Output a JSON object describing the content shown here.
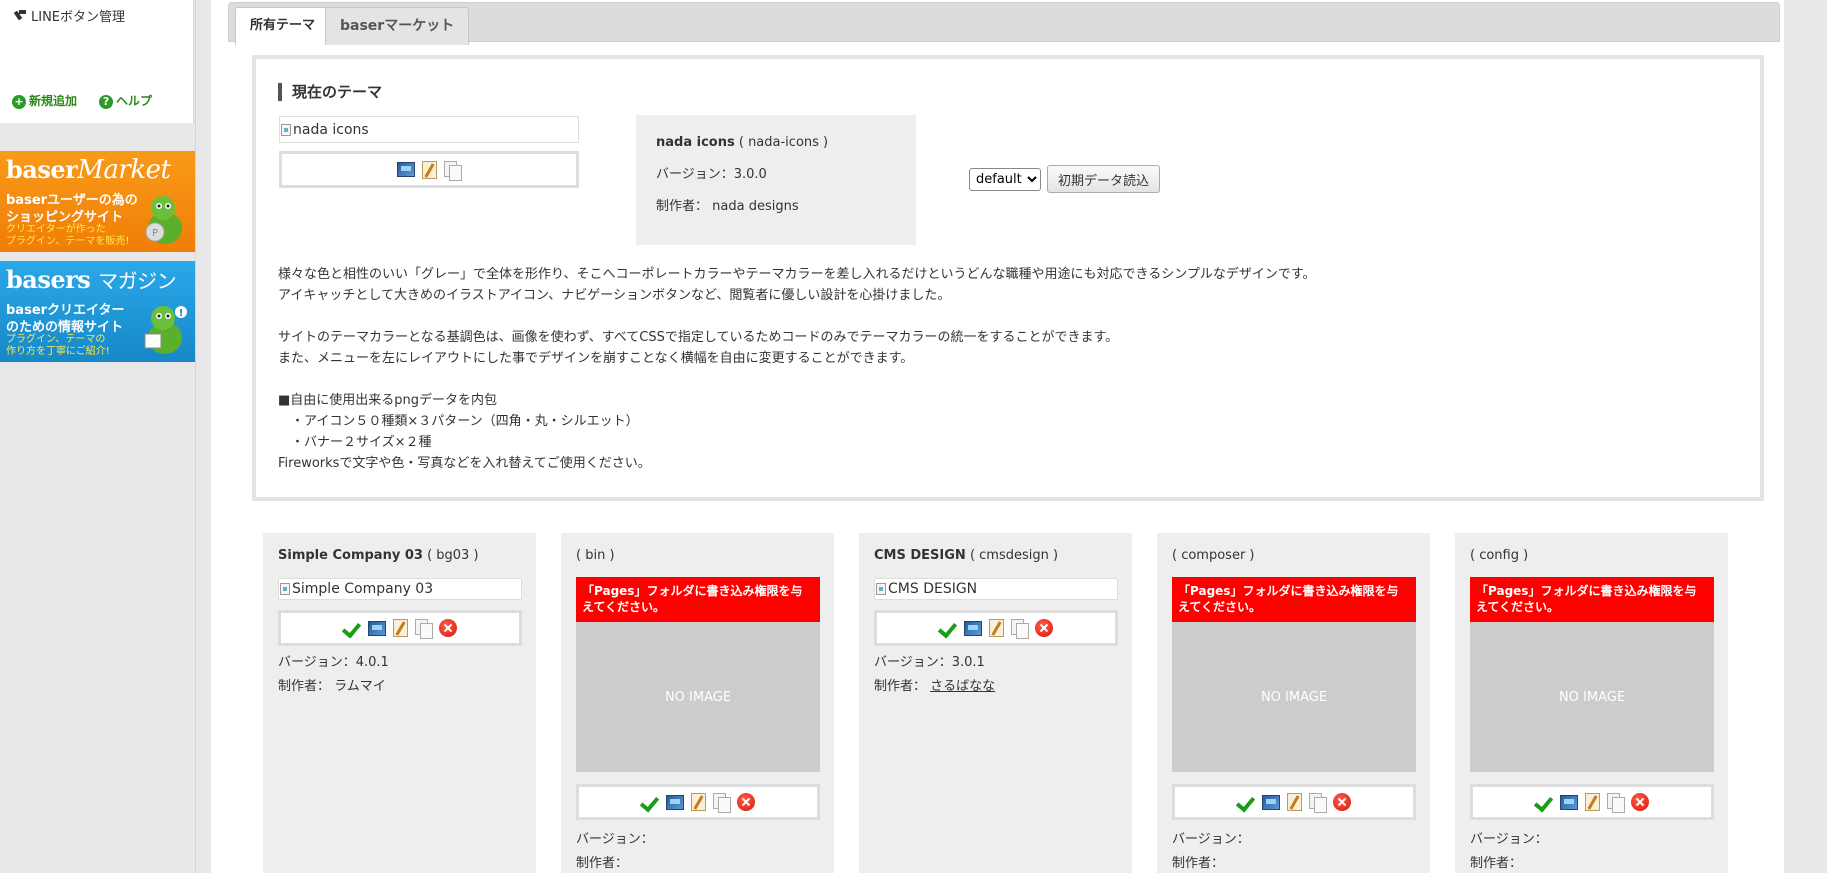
{
  "sidebar": {
    "menu_item": "LINEボタン管理",
    "add_label": "新規追加",
    "help_label": "ヘルプ",
    "banner_market": {
      "title_a": "baser",
      "title_b": "Market",
      "line1": "baserユーザーの為の",
      "line2": "ショッピングサイト",
      "small1": "クリエイターが作った",
      "small2": "プラグイン、テーマを販売!"
    },
    "banner_magazine": {
      "title_a": "basers",
      "title_b": "マガジン",
      "line1": "baserクリエイター",
      "line2": "のための情報サイト",
      "small1": "プラグイン、テーマの",
      "small2": "作り方を丁寧にご紹介!"
    }
  },
  "tabs": {
    "owned": "所有テーマ",
    "market": "baserマーケット"
  },
  "current": {
    "heading": "現在のテーマ",
    "img_alt": "nada icons",
    "name": "nada icons",
    "slug": "( nada-icons )",
    "version": "バージョン：3.0.0",
    "author_label": "制作者：",
    "author": "nada designs",
    "select_value": "default",
    "init_button": "初期データ読込",
    "description": [
      "様々な色と相性のいい「グレー」で全体を形作り、そこへコーポレートカラーやテーマカラーを差し入れるだけというどんな職種や用途にも対応できるシンプルなデザインです。",
      "アイキャッチとして大きめのイラストアイコン、ナビゲーションボタンなど、閲覧者に優しい設計を心掛けました。",
      "",
      "サイトのテーマカラーとなる基調色は、画像を使わず、すべてCSSで指定しているためコードのみでテーマカラーの統一をすることができます。",
      "また、メニューを左にレイアウトにした事でデザインを崩すことなく横幅を自由に変更することができます。",
      "",
      "■自由に使用出来るpngデータを内包",
      "　・アイコン５０種類×３パターン（四角・丸・シルエット）",
      "　・バナー２サイズ×２種",
      "Fireworksで文字や色・写真などを入れ替えてご使用ください。"
    ]
  },
  "cards": [
    {
      "name": "Simple Company 03",
      "slug": "( bg03 )",
      "img_alt": "Simple Company 03",
      "version": "バージョン：4.0.1",
      "author_label": "制作者：",
      "author": "ラムマイ"
    },
    {
      "name": "",
      "slug": "( bin )",
      "warning": "「Pages」フォルダに書き込み権限を与えてください。",
      "noimage": "NO IMAGE",
      "version": "バージョン：",
      "author_label": "制作者："
    },
    {
      "name": "CMS DESIGN",
      "slug": "( cmsdesign )",
      "img_alt": "CMS DESIGN",
      "version": "バージョン：3.0.1",
      "author_label": "制作者：",
      "author": "さるばなな"
    },
    {
      "name": "",
      "slug": "( composer )",
      "warning": "「Pages」フォルダに書き込み権限を与えてください。",
      "noimage": "NO IMAGE",
      "version": "バージョン：",
      "author_label": "制作者："
    },
    {
      "name": "",
      "slug": "( config )",
      "warning": "「Pages」フォルダに書き込み権限を与えてください。",
      "noimage": "NO IMAGE",
      "version": "バージョン：",
      "author_label": "制作者："
    }
  ],
  "icons": [
    "apply-check-icon",
    "screenshot-icon",
    "edit-icon",
    "copy-icon",
    "delete-icon"
  ],
  "colors": {
    "warning": "#ff0000",
    "noimage_bg": "#cccccc",
    "check": "#1a9c1a",
    "market_orange": "#f07e06",
    "magazine_blue": "#1688c8"
  }
}
